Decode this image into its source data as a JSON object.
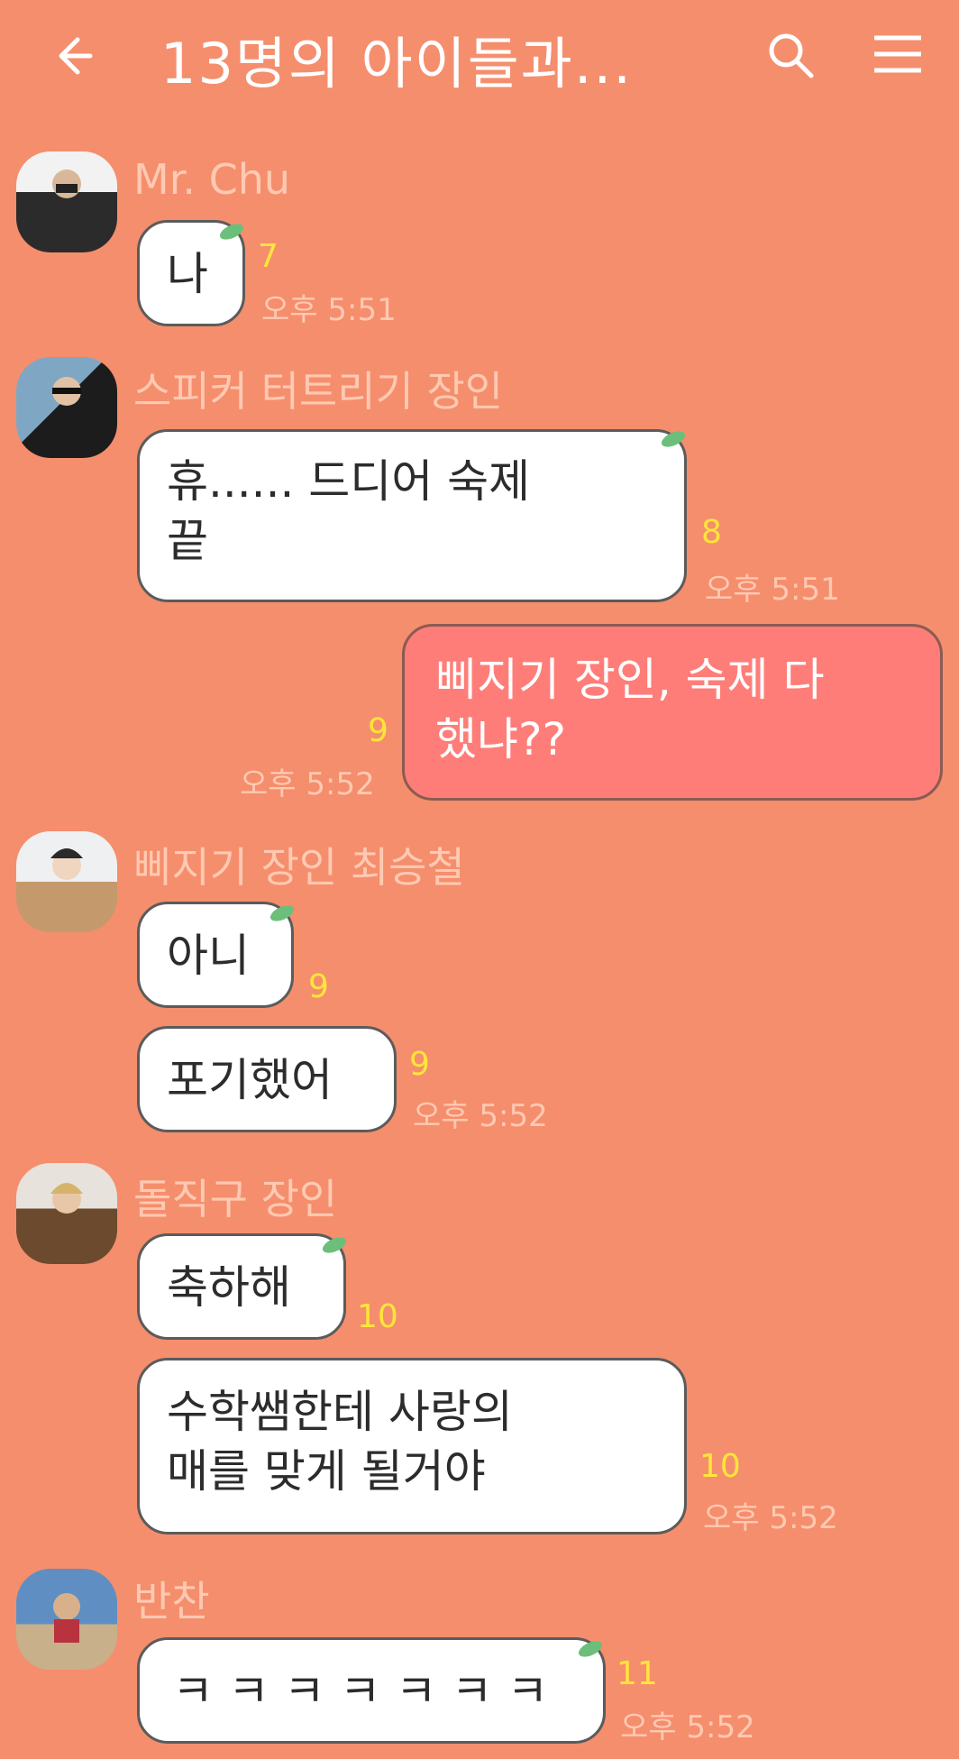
{
  "header": {
    "title": "13명의 아이들과...",
    "back_icon": "arrow-left-icon",
    "search_icon": "search-icon",
    "menu_icon": "hamburger-menu-icon"
  },
  "colors": {
    "background": "#f58e6d",
    "bubble": "#ffffff",
    "my_bubble": "#ff7d78",
    "sender_name": "#ffc9b2",
    "unread_count": "#ffe53b",
    "leaf": "#6cbf7a"
  },
  "messages": [
    {
      "sender": "Mr. Chu",
      "text": "나",
      "count": "7",
      "time": "오후 5:51"
    },
    {
      "sender": "스피커 터트리기 장인",
      "text": "휴...... 드디어 숙제\n끝",
      "count": "8",
      "time": "오후 5:51"
    },
    {
      "text": "삐지기 장인, 숙제 다\n했냐??",
      "count": "9",
      "time": "오후 5:52"
    },
    {
      "sender": "삐지기 장인 최승철",
      "text": "아니",
      "count": "9"
    },
    {
      "text": "포기했어",
      "count": "9",
      "time": "오후 5:52"
    },
    {
      "sender": "돌직구 장인",
      "text": "축하해",
      "count": "10"
    },
    {
      "text": "수학쌤한테 사랑의\n매를 맞게 될거야",
      "count": "10",
      "time": "오후 5:52"
    },
    {
      "sender": "반찬",
      "text": "ㅋ ㅋ ㅋ ㅋ ㅋ ㅋ ㅋ",
      "count": "11",
      "time": "오후 5:52"
    }
  ]
}
